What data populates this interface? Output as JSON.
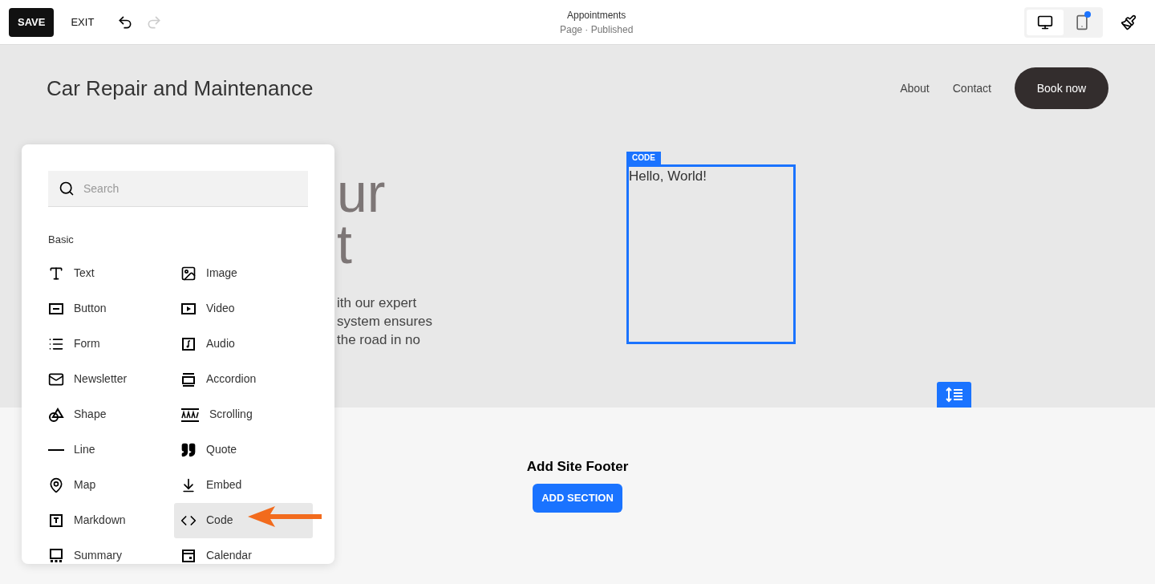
{
  "toolbar": {
    "save": "SAVE",
    "exit": "EXIT",
    "undo": {
      "disabled": false
    },
    "redo": {
      "disabled": true
    },
    "title": "Appointments",
    "subtitle": "Page · Published",
    "devices": [
      {
        "selected": true,
        "badge": false
      },
      {
        "selected": false,
        "badge": true
      }
    ]
  },
  "site_header": {
    "title": "Car Repair and Maintenance",
    "nav": [
      "About",
      "Contact"
    ],
    "cta": "Book now"
  },
  "hero": {
    "heading_lines": [
      "ur",
      "t"
    ],
    "body_lines": [
      "ith our expert",
      "system ensures",
      "the road in no"
    ]
  },
  "code_block": {
    "label": "CODE",
    "content": "Hello, World!"
  },
  "footer": {
    "title": "Add Site Footer",
    "button": "ADD SECTION"
  },
  "block_picker": {
    "search": {
      "placeholder": "Search"
    },
    "section": "Basic",
    "items": [
      {
        "label": "Text",
        "selected": false
      },
      {
        "label": "Image",
        "selected": false
      },
      {
        "label": "Button",
        "selected": false
      },
      {
        "label": "Video",
        "selected": false
      },
      {
        "label": "Form",
        "selected": false
      },
      {
        "label": "Audio",
        "selected": false
      },
      {
        "label": "Newsletter",
        "selected": false
      },
      {
        "label": "Accordion",
        "selected": false
      },
      {
        "label": "Shape",
        "selected": false
      },
      {
        "label": "Scrolling",
        "selected": false
      },
      {
        "label": "Line",
        "selected": false
      },
      {
        "label": "Quote",
        "selected": false
      },
      {
        "label": "Map",
        "selected": false
      },
      {
        "label": "Embed",
        "selected": false
      },
      {
        "label": "Markdown",
        "selected": false
      },
      {
        "label": "Code",
        "selected": true
      },
      {
        "label": "Summary",
        "selected": false
      },
      {
        "label": "Calendar",
        "selected": false
      }
    ]
  }
}
